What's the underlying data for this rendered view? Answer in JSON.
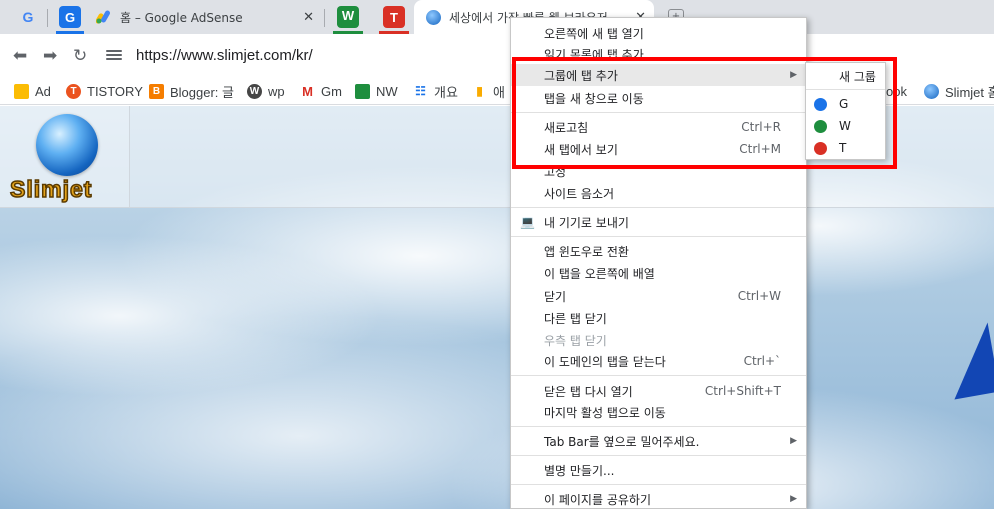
{
  "tabs": [
    {
      "label": "",
      "icon": "google-g-icon"
    },
    {
      "label": "G",
      "icon": "g-box-icon"
    },
    {
      "label": "홈 – Google AdSense",
      "icon": "adsense-icon"
    },
    {
      "label": "W",
      "icon": "w-box-icon"
    },
    {
      "label": "T",
      "icon": "t-box-icon"
    },
    {
      "label": "세상에서 가장 빠른 웹 브라우저",
      "icon": "globe-icon"
    }
  ],
  "close_glyph": "✕",
  "new_tab_glyph": "+",
  "toolbar": {
    "url": "https://www.slimjet.com/kr/",
    "back_icon": "back-arrow-icon",
    "forward_icon": "forward-arrow-icon",
    "reload_icon": "reload-icon"
  },
  "bookmarks": [
    "Ad",
    "TISTORY",
    "Blogger: 글",
    "wp",
    "Gm",
    "NW",
    "개요",
    "애",
    "ook",
    "Slimjet 홈"
  ],
  "page": {
    "logo_text": "Slimjet"
  },
  "context_menu": {
    "items": [
      {
        "label": "오른쪽에 새 탭 열기",
        "shortcut": ""
      },
      {
        "label": "읽기 목록에 탭 추가",
        "shortcut": ""
      },
      {
        "label": "그룹에 탭 추가",
        "shortcut": "",
        "submenu": true
      },
      {
        "label": "탭을 새 창으로 이동",
        "shortcut": ""
      },
      {
        "label": "새로고침",
        "shortcut": "Ctrl+R"
      },
      {
        "label": "새 탭에서 보기",
        "shortcut": "Ctrl+M"
      },
      {
        "label": "고정",
        "shortcut": ""
      },
      {
        "label": "사이트 음소거",
        "shortcut": ""
      },
      {
        "label": "내 기기로 보내기",
        "shortcut": ""
      },
      {
        "label": "앱 윈도우로 전환",
        "shortcut": ""
      },
      {
        "label": "이 탭을 오른쪽에 배열",
        "shortcut": ""
      },
      {
        "label": "닫기",
        "shortcut": "Ctrl+W"
      },
      {
        "label": "다른 탭 닫기",
        "shortcut": ""
      },
      {
        "label": "우측 탭 닫기",
        "shortcut": ""
      },
      {
        "label": "이 도메인의 탭을 닫는다",
        "shortcut": "Ctrl+`"
      },
      {
        "label": "닫은 탭 다시 열기",
        "shortcut": "Ctrl+Shift+T"
      },
      {
        "label": "마지막 활성 탭으로 이동",
        "shortcut": ""
      },
      {
        "label": "Tab  Bar를 옆으로 밀어주세요.",
        "shortcut": "",
        "submenu": true
      },
      {
        "label": "별명 만들기...",
        "shortcut": ""
      },
      {
        "label": "이 페이지를 공유하기",
        "shortcut": "",
        "submenu": true
      }
    ],
    "submenu_arrow": "▶"
  },
  "group_submenu": {
    "new_group": "새 그룹",
    "groups": [
      {
        "name": "G",
        "color": "#1a73e8"
      },
      {
        "name": "W",
        "color": "#1e8e3e"
      },
      {
        "name": "T",
        "color": "#d93025"
      }
    ]
  },
  "colors": {
    "highlight_border": "#ff0000",
    "group_blue": "#1a73e8",
    "group_green": "#1e8e3e",
    "group_red": "#d93025"
  }
}
